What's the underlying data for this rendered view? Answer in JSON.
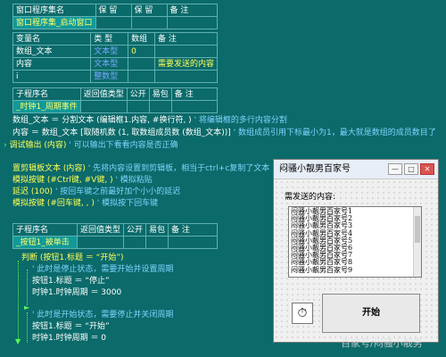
{
  "window_table": {
    "headers": [
      "窗口程序集名",
      "保 留",
      "保 留",
      "备 注"
    ],
    "row": [
      "窗口程序集_启动窗口",
      "",
      "",
      ""
    ]
  },
  "var_table": {
    "headers": [
      "变量名",
      "类 型",
      "数组",
      "备 注"
    ],
    "rows": [
      [
        "数组_文本",
        "文本型",
        "0",
        ""
      ],
      [
        "内容",
        "文本型",
        "",
        "需要发送的内容"
      ],
      [
        "i",
        "整数型",
        "",
        ""
      ]
    ]
  },
  "sub_table1": {
    "headers": [
      "子程序名",
      "返回值类型",
      "公开",
      "易包",
      "备 注"
    ],
    "row": [
      "_时钟1_周期事件",
      "",
      "",
      "",
      ""
    ]
  },
  "code1": [
    {
      "a": "数组_文本 ＝ 分割文本 (编辑框1.内容, #换行符, )",
      "c": "' 将编辑框的多行内容分割"
    },
    {
      "a": "内容 ＝ 数组_文本 [取随机数 (1, 取数组成员数 (数组_文本))]",
      "c": "' 数组成员引用下标最小为1，最大就是数组的成员数目了"
    },
    {
      "a": "调试输出 (内容)",
      "c": "' 可以输出下看看内容是否正确"
    }
  ],
  "code2": [
    {
      "a": "置剪辑板文本 (内容)",
      "c": "' 先将内容设置到剪辑板，相当于ctrl+c复制了文本"
    },
    {
      "a": "模拟按键 (#Ctrl键, #V键, )",
      "c": "' 模拟粘贴"
    },
    {
      "a": "延迟 (100)",
      "c": "' 按回车键之前最好加个小小的延迟"
    },
    {
      "a": "模拟按键 (#回车键, , )",
      "c": "' 模拟按下回车键"
    }
  ],
  "sub_table2": {
    "headers": [
      "子程序名",
      "返回值类型",
      "公开",
      "易包",
      "备 注"
    ],
    "row": [
      "_按钮1_被单击",
      "",
      "",
      "",
      ""
    ]
  },
  "code3": [
    {
      "a": "判断 (按钮1.标题 ＝ “开始”)",
      "c": ""
    },
    {
      "a": "",
      "c": "' 此时是停止状态，需要开始并设置周期"
    },
    {
      "a": "按钮1.标题 ＝ “停止”",
      "c": ""
    },
    {
      "a": "时钟1.时钟周期 ＝ 3000",
      "c": ""
    },
    {
      "a": "",
      "c": "' 此时是开始状态，需要停止并关闭周期"
    },
    {
      "a": "按钮1.标题 ＝ “开始”",
      "c": ""
    },
    {
      "a": "时钟1.时钟周期 ＝ 0",
      "c": ""
    }
  ],
  "dialog": {
    "title": "闷骚小靓男百家号",
    "label": "需发送的内容:",
    "list_items": [
      "闷骚小靓男百家号1",
      "闷骚小靓男百家号2",
      "闷骚小靓男百家号3",
      "闷骚小靓男百家号4",
      "闷骚小靓男百家号5",
      "闷骚小靓男百家号6",
      "闷骚小靓男百家号7",
      "闷骚小靓男百家号8",
      "闷骚小靓男百家号9"
    ],
    "button_label": "开始",
    "minimize": "—",
    "maximize": "□",
    "close": "✕",
    "timer_icon": "stopwatch-icon"
  },
  "watermark": "百家号/闷骚小靓男"
}
